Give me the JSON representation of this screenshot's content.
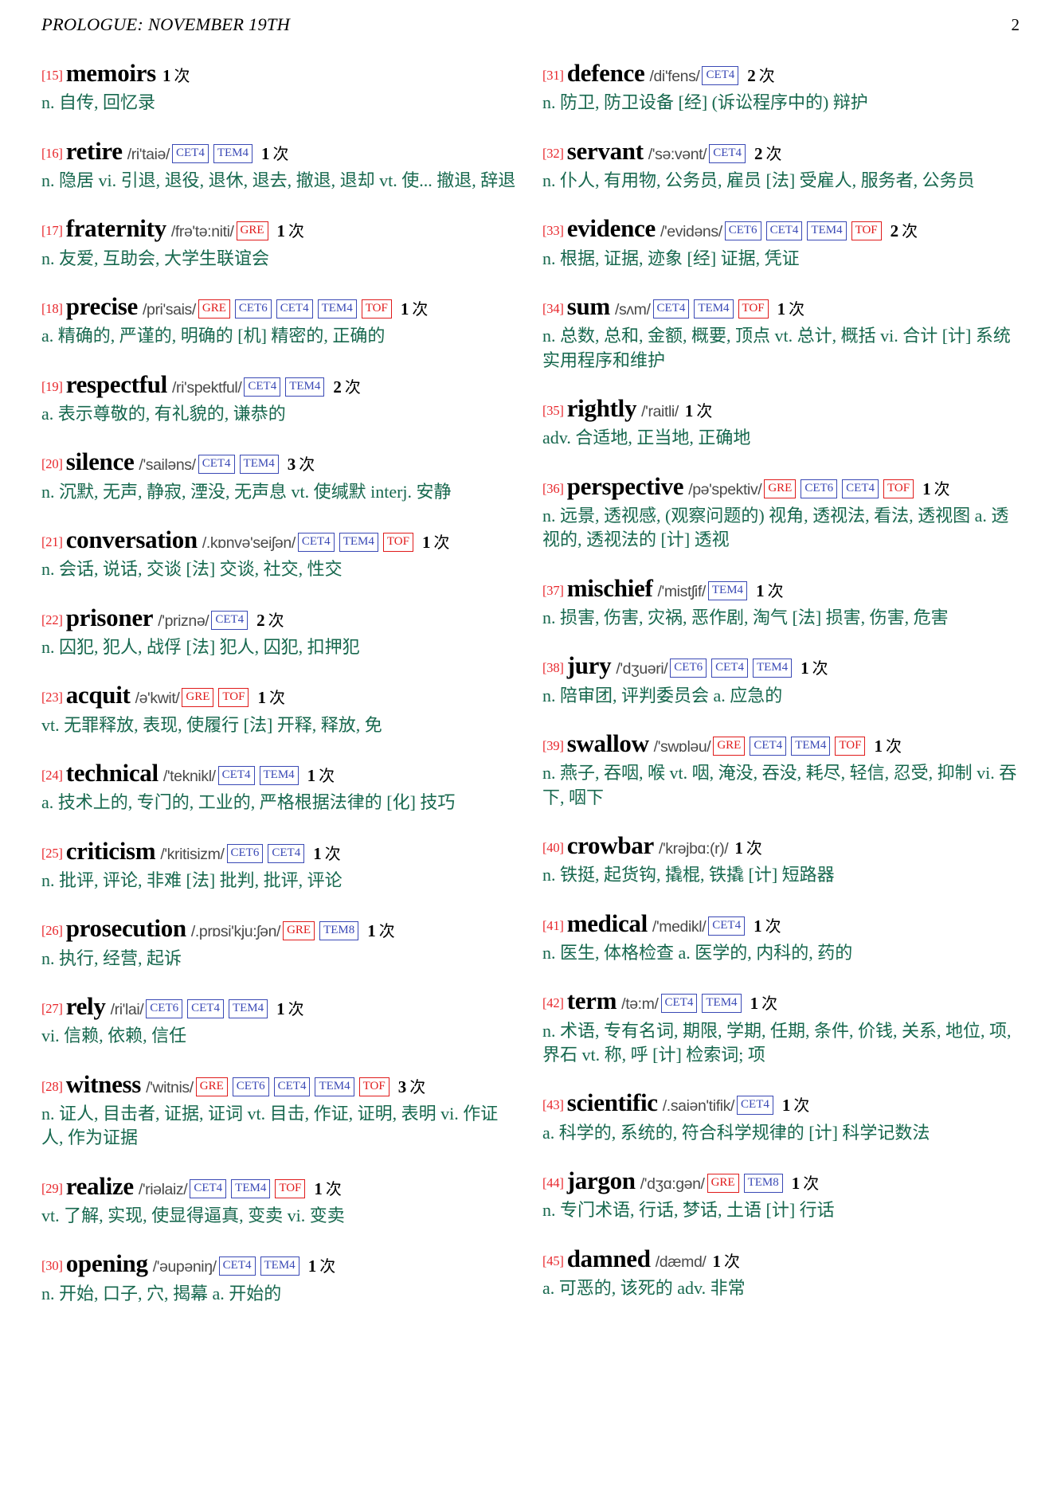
{
  "header": {
    "running_title": "PROLOGUE: NOVEMBER 19TH",
    "page_number": "2"
  },
  "labels": {
    "freq_unit": "次"
  },
  "colors": {
    "index_red": "#e8262b",
    "tag_blue": "#3a49b5",
    "tag_red": "#e01b1b",
    "definition_green": "#17684e",
    "phonetic_gray": "#4a4a4a"
  },
  "columns": [
    {
      "name": "left-column",
      "entries": [
        {
          "index": "[15]",
          "word": "memoirs",
          "phonetic": "",
          "tags": [],
          "freq": "1",
          "definition": "n. 自传, 回忆录"
        },
        {
          "index": "[16]",
          "word": "retire",
          "phonetic": "/ri'taiə/",
          "tags": [
            {
              "label": "CET4",
              "color": "blue"
            },
            {
              "label": "TEM4",
              "color": "blue"
            }
          ],
          "freq": "1",
          "definition": "n. 隐居 vi. 引退, 退役, 退休, 退去, 撤退, 退却 vt. 使... 撤退, 辞退"
        },
        {
          "index": "[17]",
          "word": "fraternity",
          "phonetic": "/frə'tə:niti/",
          "tags": [
            {
              "label": "GRE",
              "color": "red"
            }
          ],
          "freq": "1",
          "definition": "n. 友爱, 互助会, 大学生联谊会"
        },
        {
          "index": "[18]",
          "word": "precise",
          "phonetic": "/pri'sais/",
          "tags": [
            {
              "label": "GRE",
              "color": "red"
            },
            {
              "label": "CET6",
              "color": "blue"
            },
            {
              "label": "CET4",
              "color": "blue"
            },
            {
              "label": "TEM4",
              "color": "blue"
            },
            {
              "label": "TOF",
              "color": "red"
            }
          ],
          "freq": "1",
          "definition": "a. 精确的, 严谨的, 明确的 [机] 精密的, 正确的"
        },
        {
          "index": "[19]",
          "word": "respectful",
          "phonetic": "/ri'spektful/",
          "tags": [
            {
              "label": "CET4",
              "color": "blue"
            },
            {
              "label": "TEM4",
              "color": "blue"
            }
          ],
          "freq": "2",
          "definition": "a. 表示尊敬的, 有礼貌的, 谦恭的"
        },
        {
          "index": "[20]",
          "word": "silence",
          "phonetic": "/'sailəns/",
          "tags": [
            {
              "label": "CET4",
              "color": "blue"
            },
            {
              "label": "TEM4",
              "color": "blue"
            }
          ],
          "freq": "3",
          "definition": "n. 沉默, 无声, 静寂, 湮没, 无声息 vt. 使缄默 interj. 安静"
        },
        {
          "index": "[21]",
          "word": "conversation",
          "phonetic": "/.kɒnvə'seiʃən/",
          "tags": [
            {
              "label": "CET4",
              "color": "blue"
            },
            {
              "label": "TEM4",
              "color": "blue"
            },
            {
              "label": "TOF",
              "color": "red"
            }
          ],
          "freq": "1",
          "definition": "n. 会话, 说话, 交谈 [法] 交谈, 社交, 性交"
        },
        {
          "index": "[22]",
          "word": "prisoner",
          "phonetic": "/'priznə/",
          "tags": [
            {
              "label": "CET4",
              "color": "blue"
            }
          ],
          "freq": "2",
          "definition": "n. 囚犯, 犯人, 战俘 [法] 犯人, 囚犯, 扣押犯"
        },
        {
          "index": "[23]",
          "word": "acquit",
          "phonetic": "/ə'kwit/",
          "tags": [
            {
              "label": "GRE",
              "color": "red"
            },
            {
              "label": "TOF",
              "color": "red"
            }
          ],
          "freq": "1",
          "definition": "vt. 无罪释放, 表现, 使履行 [法] 开释, 释放, 免"
        },
        {
          "index": "[24]",
          "word": "technical",
          "phonetic": "/'teknikl/",
          "tags": [
            {
              "label": "CET4",
              "color": "blue"
            },
            {
              "label": "TEM4",
              "color": "blue"
            }
          ],
          "freq": "1",
          "definition": "a. 技术上的, 专门的, 工业的, 严格根据法律的 [化] 技巧"
        },
        {
          "index": "[25]",
          "word": "criticism",
          "phonetic": "/'kritisizm/",
          "tags": [
            {
              "label": "CET6",
              "color": "blue"
            },
            {
              "label": "CET4",
              "color": "blue"
            }
          ],
          "freq": "1",
          "definition": "n. 批评, 评论, 非难 [法] 批判, 批评, 评论"
        },
        {
          "index": "[26]",
          "word": "prosecution",
          "phonetic": "/.prɒsi'kju:ʃən/",
          "tags": [
            {
              "label": "GRE",
              "color": "red"
            },
            {
              "label": "TEM8",
              "color": "blue"
            }
          ],
          "freq": "1",
          "definition": "n. 执行, 经营, 起诉"
        },
        {
          "index": "[27]",
          "word": "rely",
          "phonetic": "/ri'lai/",
          "tags": [
            {
              "label": "CET6",
              "color": "blue"
            },
            {
              "label": "CET4",
              "color": "blue"
            },
            {
              "label": "TEM4",
              "color": "blue"
            }
          ],
          "freq": "1",
          "definition": "vi. 信赖, 依赖, 信任"
        },
        {
          "index": "[28]",
          "word": "witness",
          "phonetic": "/'witnis/",
          "tags": [
            {
              "label": "GRE",
              "color": "red"
            },
            {
              "label": "CET6",
              "color": "blue"
            },
            {
              "label": "CET4",
              "color": "blue"
            },
            {
              "label": "TEM4",
              "color": "blue"
            },
            {
              "label": "TOF",
              "color": "red"
            }
          ],
          "freq": "3",
          "definition": "n. 证人, 目击者, 证据, 证词 vt. 目击, 作证, 证明, 表明 vi. 作证人, 作为证据"
        },
        {
          "index": "[29]",
          "word": "realize",
          "phonetic": "/'riəlaiz/",
          "tags": [
            {
              "label": "CET4",
              "color": "blue"
            },
            {
              "label": "TEM4",
              "color": "blue"
            },
            {
              "label": "TOF",
              "color": "red"
            }
          ],
          "freq": "1",
          "definition": "vt. 了解, 实现, 使显得逼真, 变卖 vi. 变卖"
        },
        {
          "index": "[30]",
          "word": "opening",
          "phonetic": "/'əupəniŋ/",
          "tags": [
            {
              "label": "CET4",
              "color": "blue"
            },
            {
              "label": "TEM4",
              "color": "blue"
            }
          ],
          "freq": "1",
          "definition": "n. 开始, 口子, 穴, 揭幕 a. 开始的"
        }
      ]
    },
    {
      "name": "right-column",
      "entries": [
        {
          "index": "[31]",
          "word": "defence",
          "phonetic": "/di'fens/",
          "tags": [
            {
              "label": "CET4",
              "color": "blue"
            }
          ],
          "freq": "2",
          "definition": "n. 防卫, 防卫设备 [经] (诉讼程序中的) 辩护"
        },
        {
          "index": "[32]",
          "word": "servant",
          "phonetic": "/'sə:vənt/",
          "tags": [
            {
              "label": "CET4",
              "color": "blue"
            }
          ],
          "freq": "2",
          "definition": "n. 仆人, 有用物, 公务员, 雇员 [法] 受雇人, 服务者, 公务员"
        },
        {
          "index": "[33]",
          "word": "evidence",
          "phonetic": "/'evidəns/",
          "tags": [
            {
              "label": "CET6",
              "color": "blue"
            },
            {
              "label": "CET4",
              "color": "blue"
            },
            {
              "label": "TEM4",
              "color": "blue"
            },
            {
              "label": "TOF",
              "color": "red"
            }
          ],
          "freq": "2",
          "definition": "n. 根据, 证据, 迹象 [经] 证据, 凭证"
        },
        {
          "index": "[34]",
          "word": "sum",
          "phonetic": "/sʌm/",
          "tags": [
            {
              "label": "CET4",
              "color": "blue"
            },
            {
              "label": "TEM4",
              "color": "blue"
            },
            {
              "label": "TOF",
              "color": "red"
            }
          ],
          "freq": "1",
          "definition": "n. 总数, 总和, 金额, 概要, 顶点 vt. 总计, 概括 vi. 合计 [计] 系统实用程序和维护"
        },
        {
          "index": "[35]",
          "word": "rightly",
          "phonetic": "/'raitli/",
          "tags": [],
          "freq": "1",
          "definition": "adv. 合适地, 正当地, 正确地"
        },
        {
          "index": "[36]",
          "word": "perspective",
          "phonetic": "/pə'spektiv/",
          "tags": [
            {
              "label": "GRE",
              "color": "red"
            },
            {
              "label": "CET6",
              "color": "blue"
            },
            {
              "label": "CET4",
              "color": "blue"
            },
            {
              "label": "TOF",
              "color": "red"
            }
          ],
          "freq": "1",
          "definition": "n. 远景, 透视感, (观察问题的) 视角, 透视法, 看法, 透视图 a. 透视的, 透视法的 [计] 透视"
        },
        {
          "index": "[37]",
          "word": "mischief",
          "phonetic": "/'mistʃif/",
          "tags": [
            {
              "label": "TEM4",
              "color": "blue"
            }
          ],
          "freq": "1",
          "definition": "n. 损害, 伤害, 灾祸, 恶作剧, 淘气 [法] 损害, 伤害, 危害"
        },
        {
          "index": "[38]",
          "word": "jury",
          "phonetic": "/'dʒuəri/",
          "tags": [
            {
              "label": "CET6",
              "color": "blue"
            },
            {
              "label": "CET4",
              "color": "blue"
            },
            {
              "label": "TEM4",
              "color": "blue"
            }
          ],
          "freq": "1",
          "definition": "n. 陪审团, 评判委员会 a. 应急的"
        },
        {
          "index": "[39]",
          "word": "swallow",
          "phonetic": "/'swɒləu/",
          "tags": [
            {
              "label": "GRE",
              "color": "red"
            },
            {
              "label": "CET4",
              "color": "blue"
            },
            {
              "label": "TEM4",
              "color": "blue"
            },
            {
              "label": "TOF",
              "color": "red"
            }
          ],
          "freq": "1",
          "definition": "n. 燕子, 吞咽, 喉 vt. 咽, 淹没, 吞没, 耗尽, 轻信, 忍受, 抑制 vi. 吞下, 咽下"
        },
        {
          "index": "[40]",
          "word": "crowbar",
          "phonetic": "/'krəjbɑ:(r)/",
          "tags": [],
          "freq": "1",
          "definition": "n. 铁挺, 起货钩, 撬棍, 铁撬 [计] 短路器"
        },
        {
          "index": "[41]",
          "word": "medical",
          "phonetic": "/'medikl/",
          "tags": [
            {
              "label": "CET4",
              "color": "blue"
            }
          ],
          "freq": "1",
          "definition": "n. 医生, 体格检查 a. 医学的, 内科的, 药的"
        },
        {
          "index": "[42]",
          "word": "term",
          "phonetic": "/tə:m/",
          "tags": [
            {
              "label": "CET4",
              "color": "blue"
            },
            {
              "label": "TEM4",
              "color": "blue"
            }
          ],
          "freq": "1",
          "definition": "n. 术语, 专有名词, 期限, 学期, 任期, 条件, 价钱, 关系, 地位, 项, 界石 vt. 称, 呼 [计] 检索词; 项"
        },
        {
          "index": "[43]",
          "word": "scientific",
          "phonetic": "/.saiən'tifik/",
          "tags": [
            {
              "label": "CET4",
              "color": "blue"
            }
          ],
          "freq": "1",
          "definition": "a. 科学的, 系统的, 符合科学规律的 [计] 科学记数法"
        },
        {
          "index": "[44]",
          "word": "jargon",
          "phonetic": "/'dʒɑ:gən/",
          "tags": [
            {
              "label": "GRE",
              "color": "red"
            },
            {
              "label": "TEM8",
              "color": "blue"
            }
          ],
          "freq": "1",
          "definition": "n. 专门术语, 行话, 梦话, 土语 [计] 行话"
        },
        {
          "index": "[45]",
          "word": "damned",
          "phonetic": "/dæmd/",
          "tags": [],
          "freq": "1",
          "definition": "a. 可恶的, 该死的 adv. 非常"
        }
      ]
    }
  ]
}
